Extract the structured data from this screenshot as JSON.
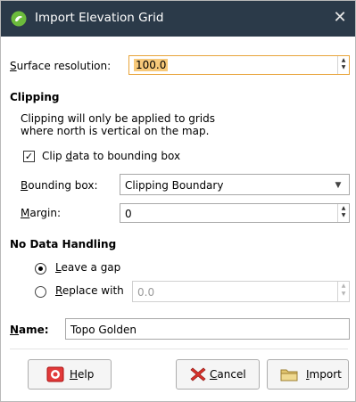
{
  "dialog": {
    "title": "Import Elevation Grid",
    "close_glyph": "✕",
    "app_icon": "leapfrog-app-icon"
  },
  "surface": {
    "label": "Surface resolution:",
    "value": "100.0"
  },
  "clipping": {
    "heading": "Clipping",
    "note_line1": "Clipping will only be applied to grids",
    "note_line2": "where north is vertical on the map.",
    "clip_checkbox_label": "Clip data to bounding box",
    "clip_checked": true,
    "bounding_label": "Bounding box:",
    "bounding_value": "Clipping Boundary",
    "margin_label": "Margin:",
    "margin_value": "0"
  },
  "nodata": {
    "heading": "No Data Handling",
    "leave_gap_label": "Leave a gap",
    "replace_label": "Replace with",
    "replace_value": "0.0",
    "selected": "leave_gap"
  },
  "name": {
    "label": "Name:",
    "value": "Topo Golden"
  },
  "buttons": {
    "help": "Help",
    "cancel": "Cancel",
    "import": "Import"
  },
  "colors": {
    "titlebar": "#2b3a49",
    "field_highlight": "#f7c97a",
    "field_highlight_border": "#e8a43a"
  }
}
